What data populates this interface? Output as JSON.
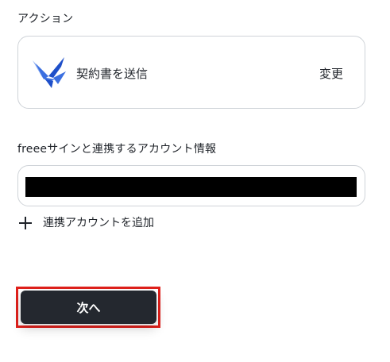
{
  "action_section": {
    "label": "アクション",
    "action_name": "契約書を送信",
    "change_label": "変更",
    "app_icon": "freee-sign-icon",
    "icon_colors": [
      "#3b6fe0",
      "#1e4fc9",
      "#7ea4f2"
    ]
  },
  "account_section": {
    "label": "freeeサインと連携するアカウント情報",
    "selected_value": "",
    "redacted": true,
    "add_account_label": "連携アカウントを追加",
    "add_icon": "plus-icon"
  },
  "footer": {
    "next_label": "次へ",
    "highlight_color": "#e0201b",
    "button_color": "#24282f"
  }
}
